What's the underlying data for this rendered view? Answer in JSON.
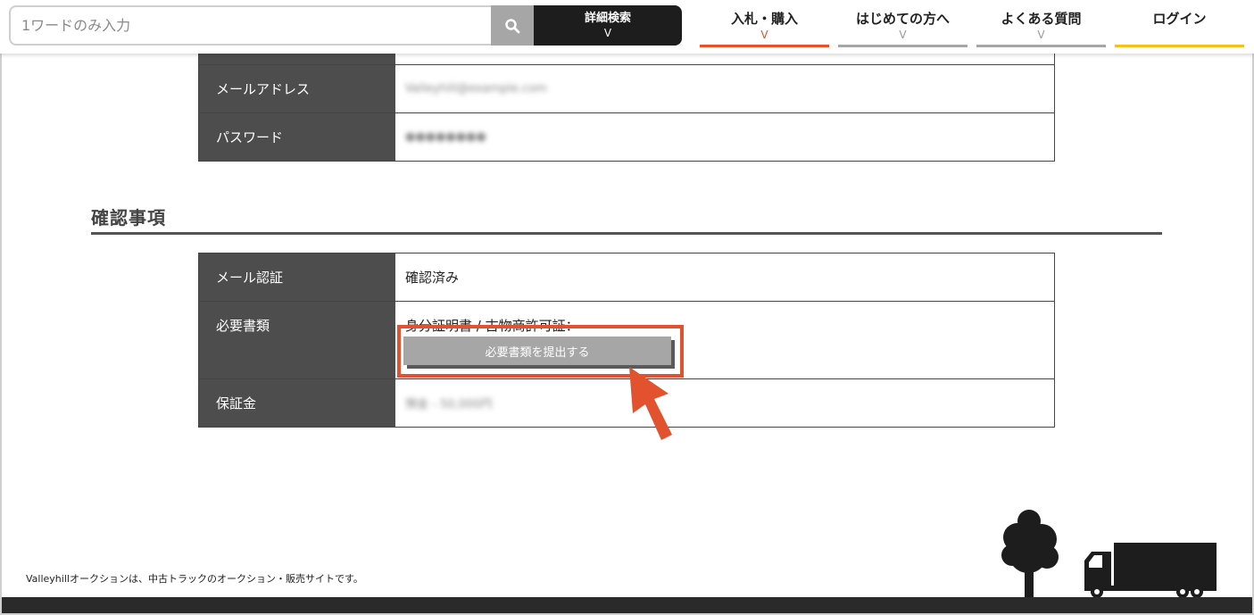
{
  "header": {
    "search_placeholder": "1ワードのみ入力",
    "search_icon": "search-icon",
    "advanced_search": {
      "label": "詳細検索",
      "chevron": "V"
    },
    "nav": [
      {
        "label": "入札・購入",
        "chevron": "V",
        "active": true
      },
      {
        "label": "はじめての方へ",
        "chevron": "V"
      },
      {
        "label": "よくある質問",
        "chevron": "V"
      },
      {
        "label": "ログイン"
      }
    ]
  },
  "account_table": {
    "rows": [
      {
        "label": "メールアドレス",
        "value": "Valleyhill@example.com"
      },
      {
        "label": "パスワード",
        "value": "●●●●●●●●"
      }
    ]
  },
  "confirm_section": {
    "title": "確認事項",
    "rows": [
      {
        "label": "メール認証",
        "value": "確認済み"
      },
      {
        "label": "必要書類",
        "value": "身分証明書 / 古物商許可証：",
        "button": "必要書類を提出する"
      },
      {
        "label": "保証金",
        "value": "預金 - 50,000円"
      }
    ]
  },
  "footer": {
    "text": "Valleyhillオークションは、中古トラックのオークション・販売サイトです。"
  },
  "colors": {
    "accent": "#e2522f",
    "dark": "#1d1d1d",
    "label_bg": "#4d4d4d",
    "login_underline": "#f0c419"
  }
}
